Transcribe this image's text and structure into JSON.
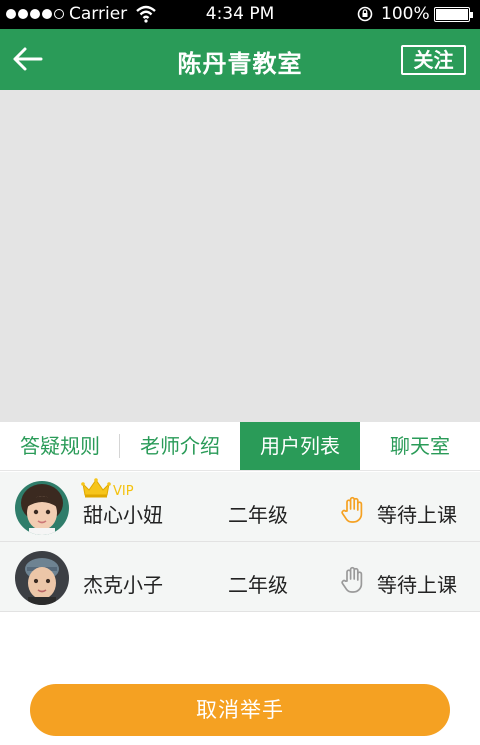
{
  "status_bar": {
    "carrier": "Carrier",
    "time": "4:34 PM",
    "battery": "100%",
    "signal_icon": "signal-dots-icon",
    "wifi_icon": "wifi-icon",
    "rotation_lock_icon": "rotation-lock-icon",
    "battery_icon": "battery-icon"
  },
  "nav": {
    "title": "陈丹青教室",
    "follow_label": "关注",
    "back_icon": "back-arrow-icon",
    "color": "#2a9b58"
  },
  "tabs": [
    {
      "label": "答疑规则",
      "active": false
    },
    {
      "label": "老师介绍",
      "active": false
    },
    {
      "label": "用户列表",
      "active": true
    },
    {
      "label": "聊天室",
      "active": false
    }
  ],
  "users": [
    {
      "name": "甜心小妞",
      "grade": "二年级",
      "status": "等待上课",
      "vip": true,
      "vip_label": "VIP",
      "hand_raised": true,
      "avatar_icon": "girl-avatar"
    },
    {
      "name": "杰克小子",
      "grade": "二年级",
      "status": "等待上课",
      "vip": false,
      "hand_raised": false,
      "avatar_icon": "boy-avatar"
    }
  ],
  "cancel_button": {
    "label": "取消举手",
    "color": "#f5a122"
  }
}
